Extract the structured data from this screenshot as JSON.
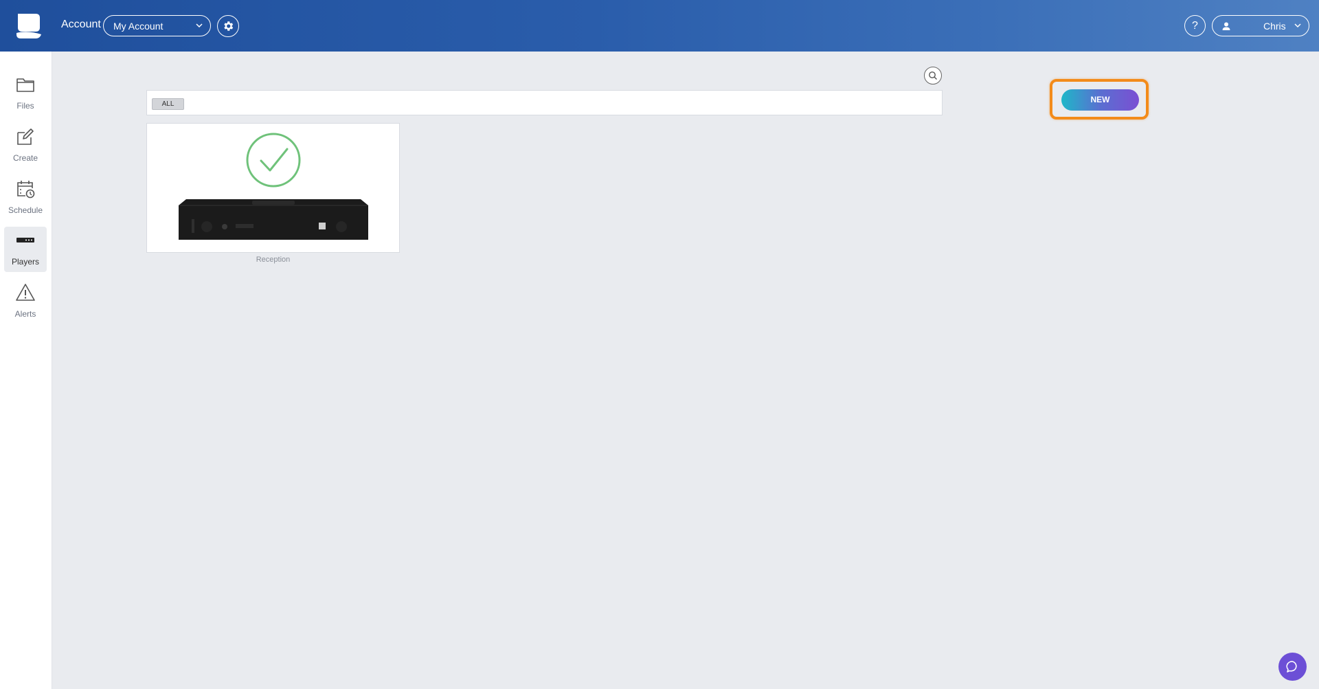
{
  "header": {
    "account_label": "Account",
    "account_select": {
      "value": "My Account"
    },
    "help_label": "?",
    "user": {
      "name": "Chris"
    }
  },
  "sidebar": {
    "items": [
      {
        "label": "Files",
        "icon": "folder-icon",
        "active": false
      },
      {
        "label": "Create",
        "icon": "edit-icon",
        "active": false
      },
      {
        "label": "Schedule",
        "icon": "calendar-clock-icon",
        "active": false
      },
      {
        "label": "Players",
        "icon": "player-device-icon",
        "active": true
      },
      {
        "label": "Alerts",
        "icon": "warning-icon",
        "active": false
      }
    ]
  },
  "main": {
    "filter": {
      "chip_label": "ALL"
    },
    "new_button_label": "NEW",
    "players": [
      {
        "name": "Reception",
        "status": "online"
      }
    ]
  },
  "colors": {
    "header_blue": "#2a5dab",
    "highlight_orange": "#f38b1a",
    "status_green": "#6fc27a",
    "chat_purple": "#6c4fd6"
  }
}
